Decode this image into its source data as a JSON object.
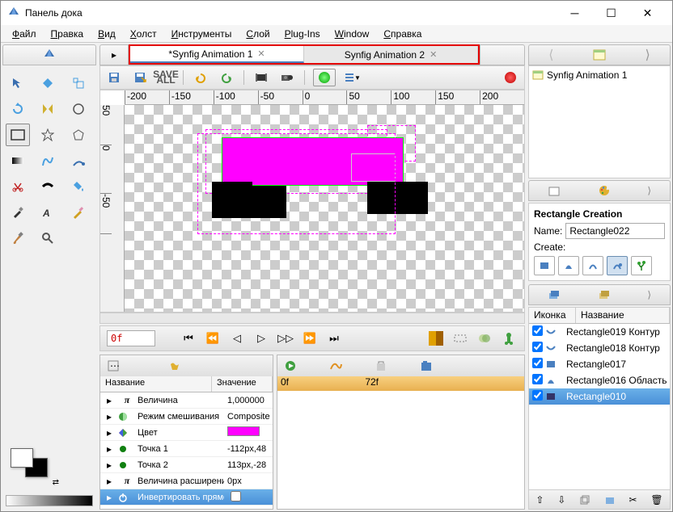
{
  "window": {
    "title": "Панель дока"
  },
  "menu": [
    "Файл",
    "Правка",
    "Вид",
    "Холст",
    "Инструменты",
    "Слой",
    "Plug-Ins",
    "Window",
    "Справка"
  ],
  "tabs": [
    {
      "label": "*Synfig Animation 1",
      "active": true
    },
    {
      "label": "Synfig Animation 2",
      "active": false
    }
  ],
  "saveall": "SAVE\nALL",
  "ruler_top": [
    "-200",
    "-150",
    "-100",
    "-50",
    "0",
    "50",
    "100",
    "150",
    "200"
  ],
  "ruler_left": [
    "50",
    "0",
    "-50"
  ],
  "time": {
    "current": "0f",
    "timeline_start": "0f",
    "timeline_marker": "72f"
  },
  "canvas_list": {
    "item": "Synfig Animation 1"
  },
  "layer_opts": {
    "title": "Rectangle Creation",
    "name_label": "Name:",
    "name_value": "Rectangle022",
    "create_label": "Create:"
  },
  "params": {
    "col_name": "Название",
    "col_value": "Значение",
    "rows": [
      {
        "icon": "π",
        "name": "Величина",
        "value": "1,000000"
      },
      {
        "icon": "◐",
        "name": "Режим смешивания",
        "value": "Composite"
      },
      {
        "icon": "◆",
        "name": "Цвет",
        "value": "",
        "color": "#ff00ff"
      },
      {
        "icon": "●",
        "name": "Точка 1",
        "value": "-112px,48"
      },
      {
        "icon": "●",
        "name": "Точка 2",
        "value": "113px,-28"
      },
      {
        "icon": "π",
        "name": "Величина расширения",
        "value": "0px"
      },
      {
        "icon": "⏻",
        "name": "Инвертировать прямоугольник",
        "value": "",
        "selected": true
      }
    ]
  },
  "layers": {
    "col_icon": "Иконка",
    "col_name": "Название",
    "rows": [
      {
        "icon": "◡",
        "name": "Rectangle019 Контур"
      },
      {
        "icon": "◡",
        "name": "Rectangle018 Контур"
      },
      {
        "icon": "■",
        "name": "Rectangle017"
      },
      {
        "icon": "◆",
        "name": "Rectangle016 Область"
      },
      {
        "icon": "■",
        "name": "Rectangle010",
        "selected": true
      }
    ]
  }
}
